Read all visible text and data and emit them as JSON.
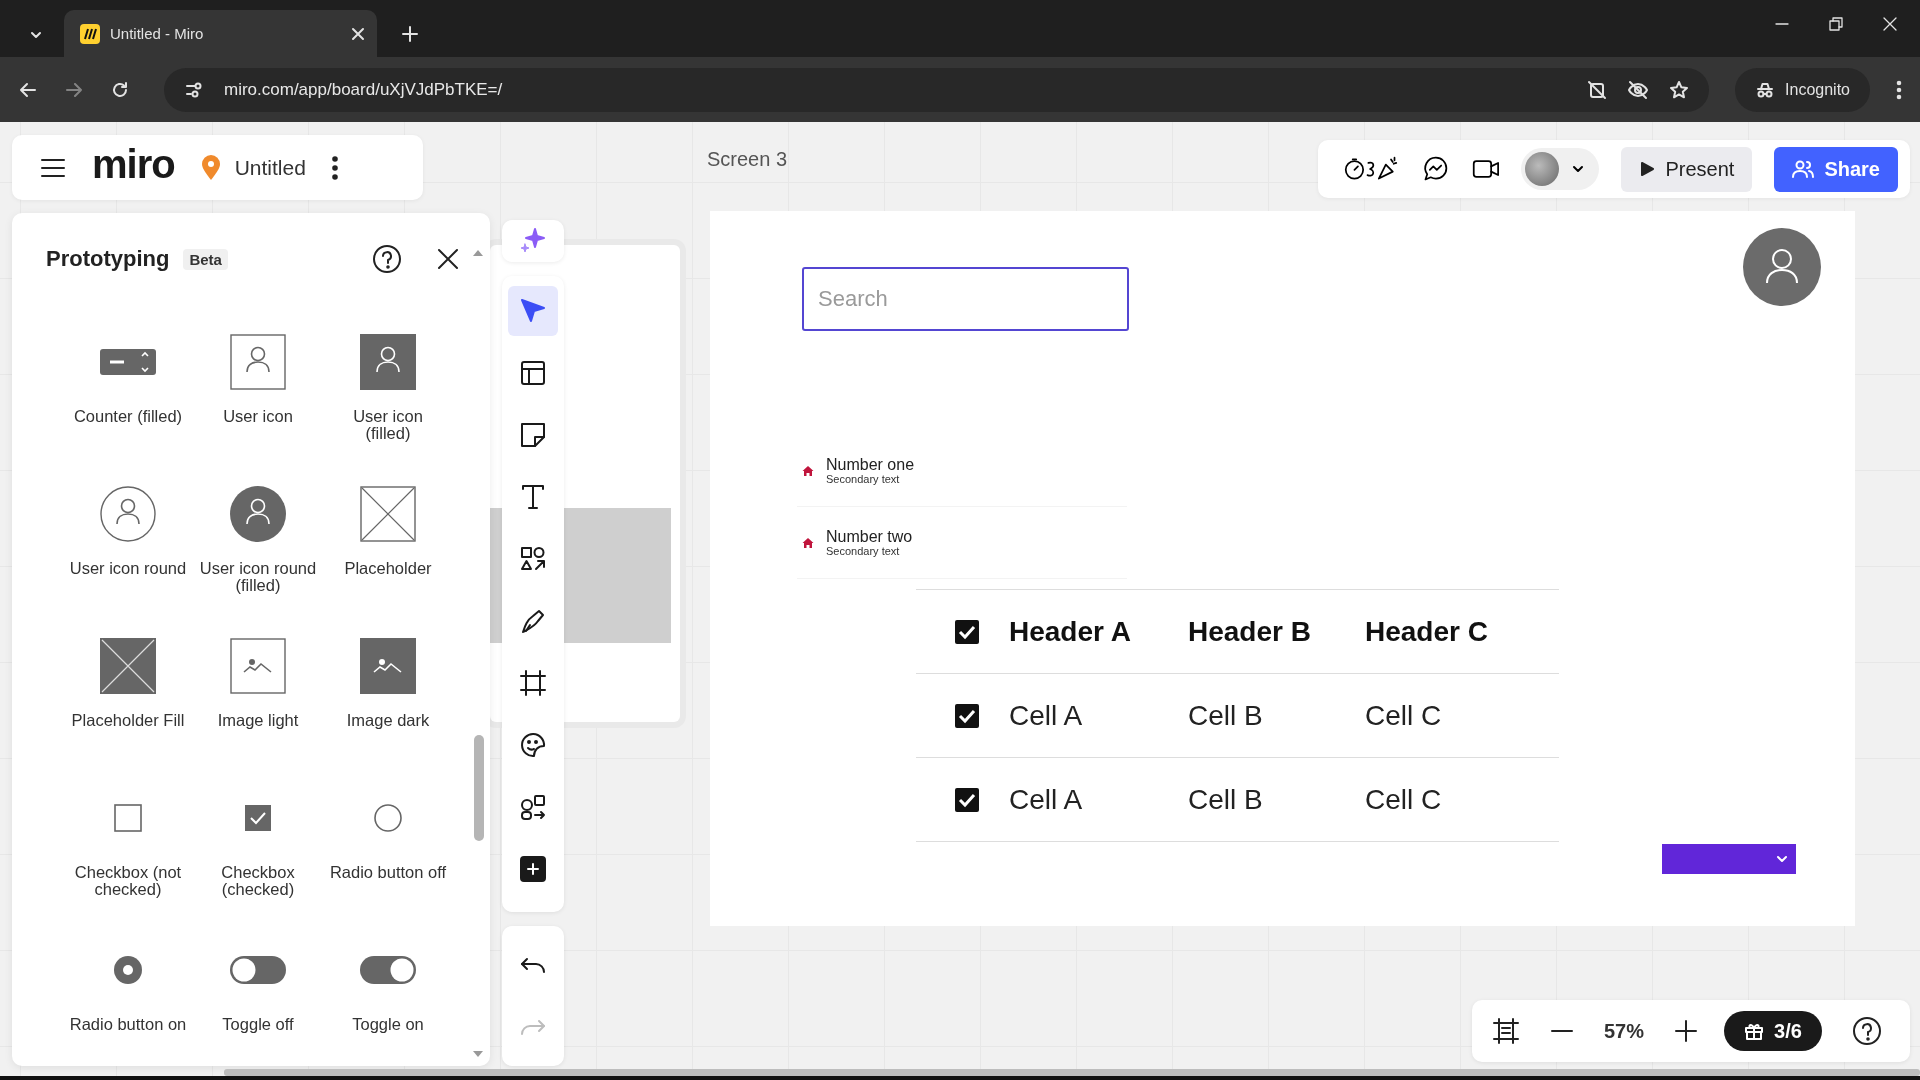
{
  "browser": {
    "tab_title": "Untitled - Miro",
    "url": "miro.com/app/board/uXjVJdPbTKE=/",
    "profile": "Incognito"
  },
  "board_header": {
    "logo": "miro",
    "board_name": "Untitled"
  },
  "frame_label": "Screen 3",
  "top_toolbar": {
    "buttons": [
      {
        "label": "Present",
        "kind": "secondary"
      },
      {
        "label": "Share",
        "kind": "primary"
      }
    ]
  },
  "panel": {
    "title": "Prototyping",
    "badge": "Beta",
    "items": [
      {
        "label": "Counter (filled)",
        "kind": "counter"
      },
      {
        "label": "User icon",
        "kind": "user"
      },
      {
        "label": "User icon (filled)",
        "kind": "user-filled"
      },
      {
        "label": "User icon round",
        "kind": "user-round"
      },
      {
        "label": "User icon round (filled)",
        "kind": "user-round-filled"
      },
      {
        "label": "Placeholder",
        "kind": "placeholder"
      },
      {
        "label": "Placeholder Fill",
        "kind": "placeholder-fill"
      },
      {
        "label": "Image light",
        "kind": "image-light"
      },
      {
        "label": "Image dark",
        "kind": "image-dark"
      },
      {
        "label": "Checkbox (not checked)",
        "kind": "checkbox-off"
      },
      {
        "label": "Checkbox (checked)",
        "kind": "checkbox-on"
      },
      {
        "label": "Radio button off",
        "kind": "radio-off"
      },
      {
        "label": "Radio button on",
        "kind": "radio-on"
      },
      {
        "label": "Toggle off",
        "kind": "toggle-off"
      },
      {
        "label": "Toggle on",
        "kind": "toggle-on"
      }
    ]
  },
  "tools": [
    {
      "kind": "select",
      "selected": true
    },
    {
      "kind": "templates",
      "selected": false
    },
    {
      "kind": "sticky",
      "selected": false
    },
    {
      "kind": "text",
      "selected": false
    },
    {
      "kind": "shapes",
      "selected": false
    },
    {
      "kind": "pen",
      "selected": false
    },
    {
      "kind": "frame",
      "selected": false
    },
    {
      "kind": "stickers",
      "selected": false
    },
    {
      "kind": "diagram",
      "selected": false
    },
    {
      "kind": "add",
      "selected": false
    }
  ],
  "history": [
    {
      "kind": "undo",
      "disabled": false
    },
    {
      "kind": "redo",
      "disabled": true
    }
  ],
  "frame": {
    "search": {
      "placeholder": "Search"
    },
    "list": [
      {
        "title": "Number one",
        "subtitle": "Secondary text"
      },
      {
        "title": "Number two",
        "subtitle": "Secondary text"
      }
    ],
    "table": {
      "columns": [
        "Header A",
        "Header B",
        "Header C"
      ],
      "header_checked": true,
      "rows": [
        {
          "checked": true,
          "cells": [
            "Cell A",
            "Cell B",
            "Cell C"
          ]
        },
        {
          "checked": true,
          "cells": [
            "Cell A",
            "Cell B",
            "Cell C"
          ]
        }
      ]
    }
  },
  "zoom": {
    "level": "57%",
    "onboarding": "3/6"
  }
}
